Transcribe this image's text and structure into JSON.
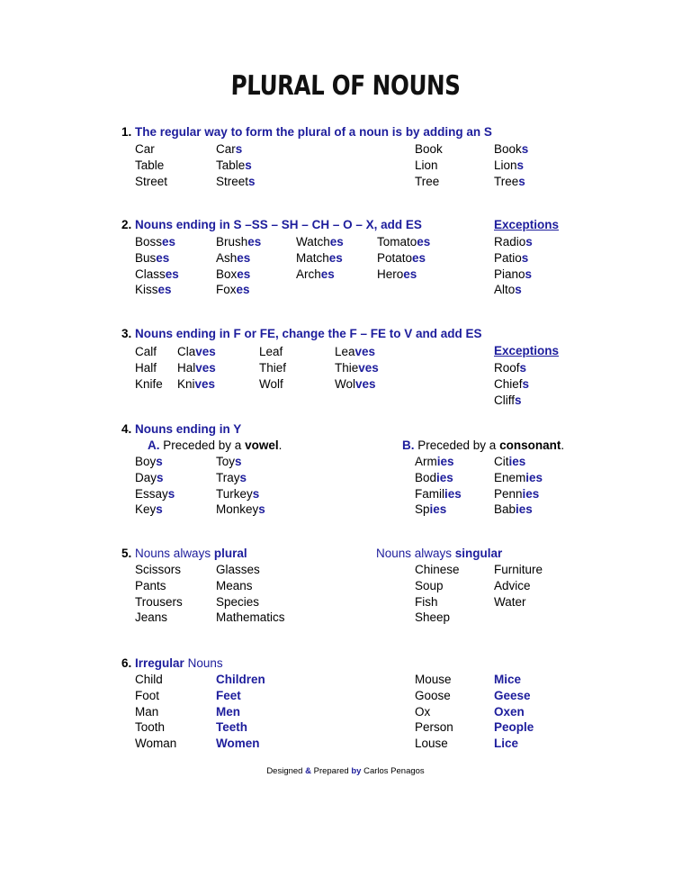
{
  "document": {
    "title": "PLURAL OF NOUNS",
    "accent_color": "#1d1d9c",
    "text_color": "#000000",
    "background_color": "#ffffff"
  },
  "sections": [
    {
      "number": "1.",
      "heading": "The regular way to form the plural of a noun is by adding an S",
      "columns": [
        {
          "words": [
            {
              "base": "Car",
              "suffix": ""
            },
            {
              "base": "Table",
              "suffix": ""
            },
            {
              "base": "Street",
              "suffix": ""
            }
          ]
        },
        {
          "words": [
            {
              "base": "Car",
              "suffix": "s"
            },
            {
              "base": "Table",
              "suffix": "s"
            },
            {
              "base": "Street",
              "suffix": "s"
            }
          ]
        },
        {
          "words": [
            {
              "base": "Book",
              "suffix": ""
            },
            {
              "base": "Lion",
              "suffix": ""
            },
            {
              "base": "Tree",
              "suffix": ""
            }
          ]
        },
        {
          "words": [
            {
              "base": "Book",
              "suffix": "s"
            },
            {
              "base": "Lion",
              "suffix": "s"
            },
            {
              "base": "Tree",
              "suffix": "s"
            }
          ]
        }
      ]
    },
    {
      "number": "2.",
      "heading": "Nouns ending in S –SS – SH – CH – O – X, add ES",
      "exceptions_label": "Exceptions",
      "columns": [
        {
          "words": [
            {
              "base": "Boss",
              "suffix": "es"
            },
            {
              "base": "Bus",
              "suffix": "es"
            },
            {
              "base": "Class",
              "suffix": "es"
            },
            {
              "base": "Kiss",
              "suffix": "es"
            }
          ]
        },
        {
          "words": [
            {
              "base": "Brush",
              "suffix": "es"
            },
            {
              "base": "Ash",
              "suffix": "es"
            },
            {
              "base": "Box",
              "suffix": "es"
            },
            {
              "base": "Fox",
              "suffix": "es"
            }
          ]
        },
        {
          "words": [
            {
              "base": "Watch",
              "suffix": "es"
            },
            {
              "base": "Match",
              "suffix": "es"
            },
            {
              "base": "Arch",
              "suffix": "es"
            }
          ]
        },
        {
          "words": [
            {
              "base": "Tomato",
              "suffix": "es"
            },
            {
              "base": "Potato",
              "suffix": "es"
            },
            {
              "base": "Hero",
              "suffix": "es"
            }
          ]
        },
        {
          "words": [
            {
              "base": "Radio",
              "suffix": "s"
            },
            {
              "base": "Patio",
              "suffix": "s"
            },
            {
              "base": "Piano",
              "suffix": "s"
            },
            {
              "base": "Alto",
              "suffix": "s"
            }
          ]
        }
      ]
    },
    {
      "number": "3.",
      "heading": "Nouns ending in F or FE, change the F – FE to V and add ES",
      "exceptions_label": "Exceptions",
      "columns": [
        {
          "words": [
            {
              "base": "Calf",
              "suffix": ""
            },
            {
              "base": "Half",
              "suffix": ""
            },
            {
              "base": "Knife",
              "suffix": ""
            }
          ]
        },
        {
          "words": [
            {
              "base": "Cla",
              "suffix": "ves"
            },
            {
              "base": "Hal",
              "suffix": "ves"
            },
            {
              "base": "Kni",
              "suffix": "ves"
            }
          ]
        },
        {
          "words": [
            {
              "base": "Leaf",
              "suffix": ""
            },
            {
              "base": "Thief",
              "suffix": ""
            },
            {
              "base": "Wolf",
              "suffix": ""
            }
          ]
        },
        {
          "words": [
            {
              "base": "Lea",
              "suffix": "ves"
            },
            {
              "base": "Thie",
              "suffix": "ves"
            },
            {
              "base": "Wol",
              "suffix": "ves"
            }
          ]
        },
        {
          "words": [
            {
              "base": "Roof",
              "suffix": "s"
            },
            {
              "base": "Chief",
              "suffix": "s"
            },
            {
              "base": "Cliff",
              "suffix": "s"
            }
          ]
        }
      ]
    },
    {
      "number": "4.",
      "heading": "Nouns ending in Y",
      "sub_a": {
        "letter": "A.",
        "text_before": " Preceded by a ",
        "emphasis": "vowel",
        "text_after": "."
      },
      "sub_b": {
        "letter": "B.",
        "text_before": " Preceded by a ",
        "emphasis": "consonant",
        "text_after": "."
      },
      "columns": [
        {
          "words": [
            {
              "base": "Boy",
              "suffix": "s"
            },
            {
              "base": "Day",
              "suffix": "s"
            },
            {
              "base": "Essay",
              "suffix": "s"
            },
            {
              "base": "Key",
              "suffix": "s"
            }
          ]
        },
        {
          "words": [
            {
              "base": "Toy",
              "suffix": "s"
            },
            {
              "base": "Tray",
              "suffix": "s"
            },
            {
              "base": "Turkey",
              "suffix": "s"
            },
            {
              "base": "Monkey",
              "suffix": "s"
            }
          ]
        },
        {
          "words": [
            {
              "base": "Arm",
              "suffix": "ies"
            },
            {
              "base": "Bod",
              "suffix": "ies"
            },
            {
              "base": "Famil",
              "suffix": "ies"
            },
            {
              "base": "Sp",
              "suffix": "ies"
            }
          ]
        },
        {
          "words": [
            {
              "base": "Cit",
              "suffix": "ies"
            },
            {
              "base": "Enem",
              "suffix": "ies"
            },
            {
              "base": "Penn",
              "suffix": "ies"
            },
            {
              "base": "Bab",
              "suffix": "ies"
            }
          ]
        }
      ]
    },
    {
      "number": "5.",
      "heading_left_before": "Nouns always ",
      "heading_left_emphasis": "plural",
      "heading_right_before": "Nouns always ",
      "heading_right_emphasis": "singular",
      "columns": [
        {
          "words": [
            {
              "base": "Scissors",
              "suffix": ""
            },
            {
              "base": "Pants",
              "suffix": ""
            },
            {
              "base": "Trousers",
              "suffix": ""
            },
            {
              "base": "Jeans",
              "suffix": ""
            }
          ]
        },
        {
          "words": [
            {
              "base": "Glasses",
              "suffix": ""
            },
            {
              "base": "Means",
              "suffix": ""
            },
            {
              "base": "Species",
              "suffix": ""
            },
            {
              "base": "Mathematics",
              "suffix": ""
            }
          ]
        },
        {
          "words": [
            {
              "base": "Chinese",
              "suffix": ""
            },
            {
              "base": "Soup",
              "suffix": ""
            },
            {
              "base": "Fish",
              "suffix": ""
            },
            {
              "base": "Sheep",
              "suffix": ""
            }
          ]
        },
        {
          "words": [
            {
              "base": "Furniture",
              "suffix": ""
            },
            {
              "base": "Advice",
              "suffix": ""
            },
            {
              "base": "Water",
              "suffix": ""
            }
          ]
        }
      ]
    },
    {
      "number": "6.",
      "heading_emphasis": "Irregular",
      "heading_rest": " Nouns",
      "columns": [
        {
          "words": [
            {
              "base": "Child",
              "suffix": ""
            },
            {
              "base": "Foot",
              "suffix": ""
            },
            {
              "base": "Man",
              "suffix": ""
            },
            {
              "base": "Tooth",
              "suffix": ""
            },
            {
              "base": "Woman",
              "suffix": ""
            }
          ]
        },
        {
          "words": [
            {
              "base": "Children",
              "suffix": ""
            },
            {
              "base": "Feet",
              "suffix": ""
            },
            {
              "base": "Men",
              "suffix": ""
            },
            {
              "base": "Teeth",
              "suffix": ""
            },
            {
              "base": "Women",
              "suffix": ""
            }
          ]
        },
        {
          "words": [
            {
              "base": "Mouse",
              "suffix": ""
            },
            {
              "base": "Goose",
              "suffix": ""
            },
            {
              "base": "Ox",
              "suffix": ""
            },
            {
              "base": "Person",
              "suffix": ""
            },
            {
              "base": "Louse",
              "suffix": ""
            }
          ]
        },
        {
          "words": [
            {
              "base": "Mice",
              "suffix": ""
            },
            {
              "base": "Geese",
              "suffix": ""
            },
            {
              "base": "Oxen",
              "suffix": ""
            },
            {
              "base": "People",
              "suffix": ""
            },
            {
              "base": "Lice",
              "suffix": ""
            }
          ]
        }
      ]
    }
  ],
  "footer": {
    "part1": "Designed ",
    "amp": "&",
    "part2": " Prepared ",
    "by": "by",
    "part3": " Carlos Penagos"
  }
}
